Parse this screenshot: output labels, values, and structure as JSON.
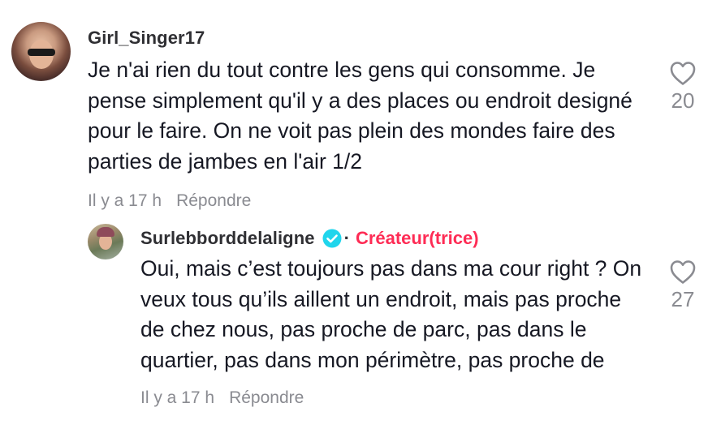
{
  "comments": [
    {
      "username": "Girl_Singer17",
      "text": "Je n'ai rien du tout contre les gens qui consomme. Je pense simplement qu'il y a des places ou endroit designé pour le faire. On ne voit pas plein des mondes faire des parties de jambes en l'air 1/2",
      "time": "Il y a 17 h",
      "reply_label": "Répondre",
      "likes": "20"
    },
    {
      "username": "Surlebborddelaligne",
      "verified": true,
      "separator": "·",
      "badge": "Créateur(trice)",
      "text": "Oui, mais c’est toujours pas dans ma cour right ? On veux tous qu’ils aillent un endroit, mais pas proche de chez nous, pas proche de parc, pas dans le quartier, pas dans mon périmètre, pas proche de",
      "time": "Il y a 17 h",
      "reply_label": "Répondre",
      "likes": "27"
    }
  ],
  "colors": {
    "text": "#161823",
    "muted": "#8a8b91",
    "creator_badge": "#fe2c55",
    "verified": "#20d5ec"
  },
  "icons": {
    "like": "heart-outline-icon",
    "verified": "verified-check-icon"
  }
}
